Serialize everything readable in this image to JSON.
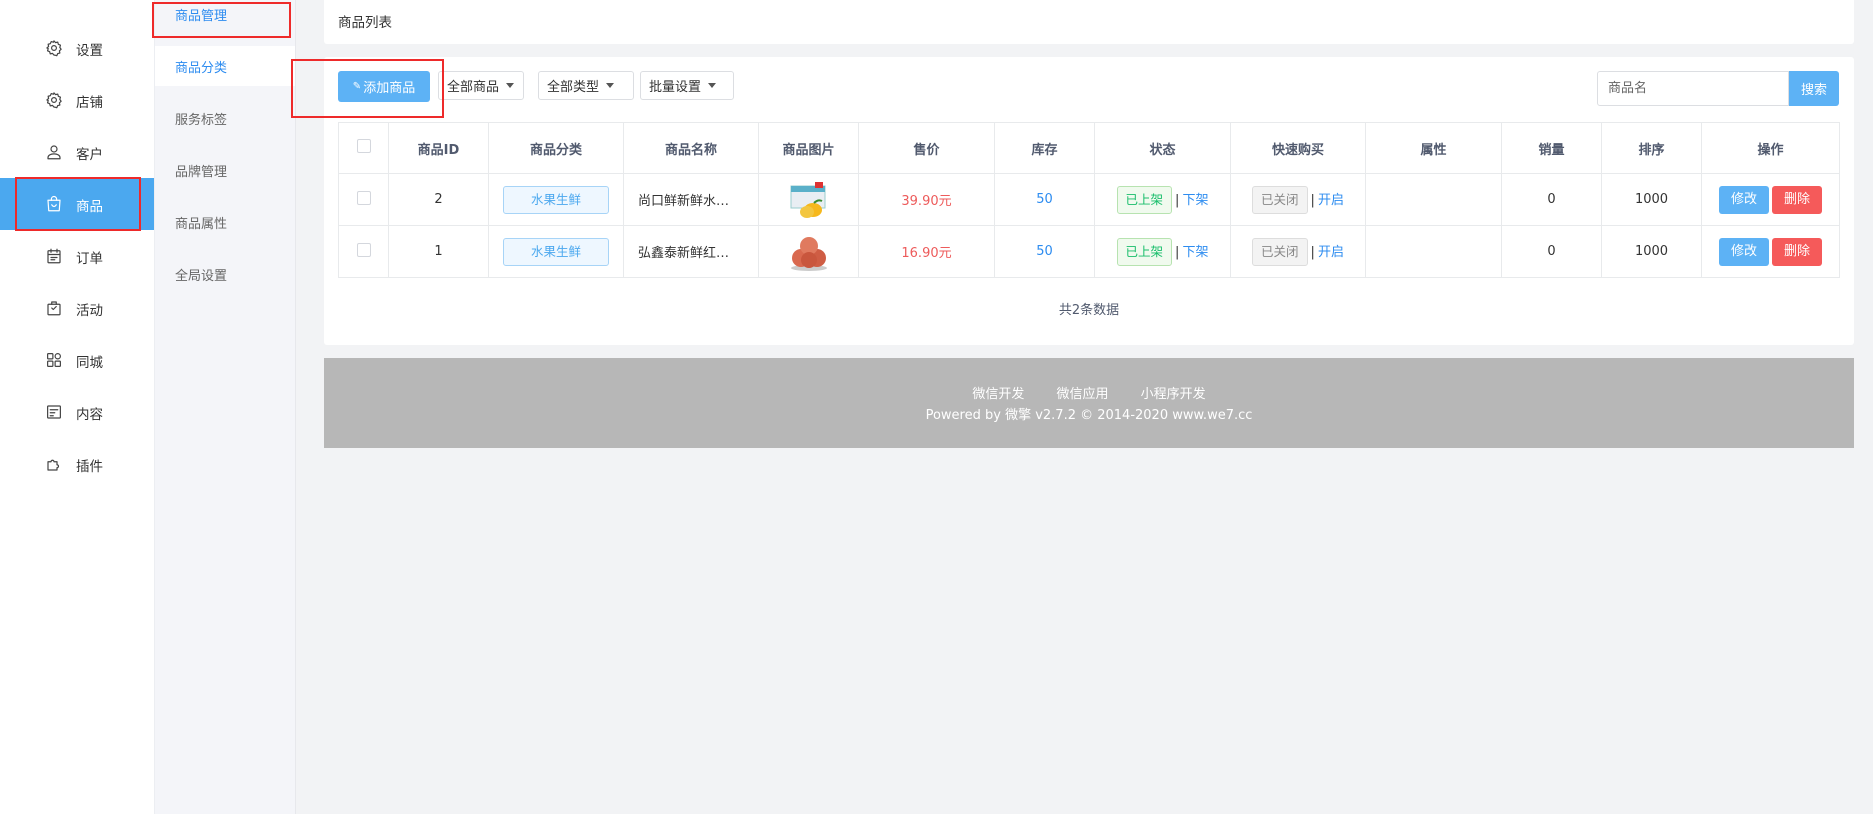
{
  "sidebar": {
    "items": [
      {
        "label": "设置",
        "icon": "gear-icon"
      },
      {
        "label": "店铺",
        "icon": "gear-icon"
      },
      {
        "label": "客户",
        "icon": "user-icon"
      },
      {
        "label": "商品",
        "icon": "shopping-bag-icon"
      },
      {
        "label": "订单",
        "icon": "calendar-icon"
      },
      {
        "label": "活动",
        "icon": "gift-bag-icon"
      },
      {
        "label": "同城",
        "icon": "apps-icon"
      },
      {
        "label": "内容",
        "icon": "document-icon"
      },
      {
        "label": "插件",
        "icon": "puzzle-icon"
      }
    ]
  },
  "subnav": {
    "items": [
      {
        "label": "商品管理"
      },
      {
        "label": "商品分类"
      },
      {
        "label": "服务标签"
      },
      {
        "label": "品牌管理"
      },
      {
        "label": "商品属性"
      },
      {
        "label": "全局设置"
      }
    ]
  },
  "header": {
    "title": "商品列表"
  },
  "toolbar": {
    "add_label": "添加商品",
    "filter_all_goods": "全部商品",
    "filter_all_types": "全部类型",
    "batch_settings": "批量设置",
    "search_placeholder": "商品名",
    "search_label": "搜索"
  },
  "table": {
    "columns": [
      "商品ID",
      "商品分类",
      "商品名称",
      "商品图片",
      "售价",
      "库存",
      "状态",
      "快速购买",
      "属性",
      "销量",
      "排序",
      "操作"
    ],
    "rows": [
      {
        "id": "2",
        "category": "水果生鲜",
        "name": "尚口鲜新鲜水…",
        "image": "mango-box-thumbnail",
        "price": "39.90元",
        "stock": "50",
        "status": "已上架",
        "status_action": "下架",
        "quick_buy": "已关闭",
        "quick_action": "开启",
        "attr": "",
        "sales": "0",
        "sort": "1000",
        "edit": "修改",
        "delete": "删除"
      },
      {
        "id": "1",
        "category": "水果生鲜",
        "name": "弘鑫泰新鲜红…",
        "image": "red-apples-thumbnail",
        "price": "16.90元",
        "stock": "50",
        "status": "已上架",
        "status_action": "下架",
        "quick_buy": "已关闭",
        "quick_action": "开启",
        "attr": "",
        "sales": "0",
        "sort": "1000",
        "edit": "修改",
        "delete": "删除"
      }
    ],
    "sep": "|",
    "total": "共2条数据"
  },
  "footer": {
    "links": [
      "微信开发",
      "微信应用",
      "小程序开发"
    ],
    "powered": "Powered by 微擎 v2.7.2 © 2014-2020 www.we7.cc"
  },
  "colors": {
    "accent": "#4ba8ef",
    "price": "#ed5b5b",
    "link": "#2d8cf0",
    "highlight_box": "#ee2a2a"
  }
}
